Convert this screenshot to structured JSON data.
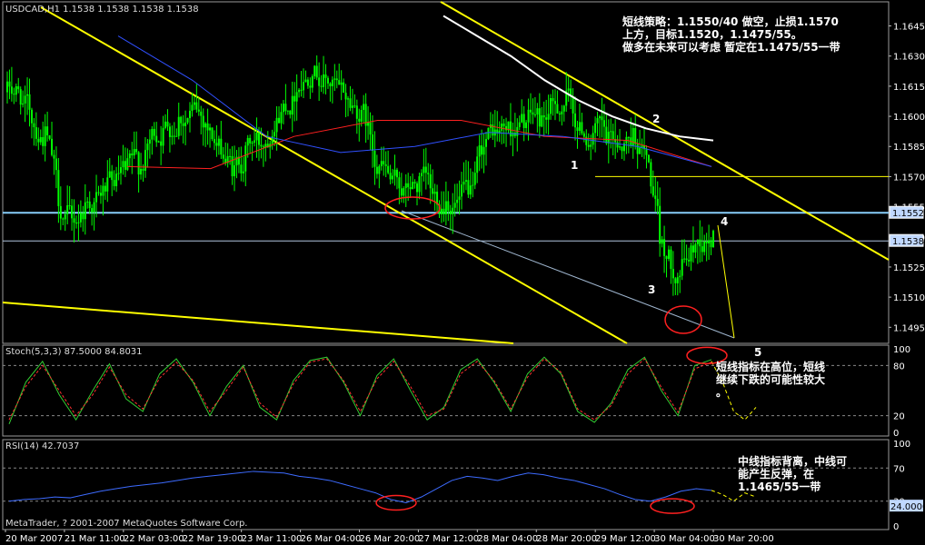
{
  "chart_data": {
    "type": "candlestick",
    "symbol_header": "USDCAD,H1  1.1538 1.1538 1.1538 1.1538",
    "price_axis": {
      "ylim": [
        1.1487,
        1.1657
      ],
      "ticks": [
        "1.1645",
        "1.1630",
        "1.1615",
        "1.1600",
        "1.1585",
        "1.1570",
        "1.1555",
        "1.1540",
        "1.1525",
        "1.1510",
        "1.1495"
      ],
      "tick_values": [
        1.1645,
        1.163,
        1.1615,
        1.16,
        1.1585,
        1.157,
        1.1555,
        1.154,
        1.1525,
        1.151,
        1.1495
      ],
      "current_price_tag": "1.1538",
      "current_price": 1.1538,
      "level_tag": "1.1552",
      "level_price": 1.1552,
      "resistance_level": 1.157
    },
    "x_axis": {
      "labels": [
        "20 Mar 2007",
        "21 Mar 11:00",
        "22 Mar 03:00",
        "22 Mar 19:00",
        "23 Mar 11:00",
        "26 Mar 04:00",
        "26 Mar 20:00",
        "27 Mar 12:00",
        "28 Mar 04:00",
        "28 Mar 20:00",
        "29 Mar 12:00",
        "30 Mar 04:00",
        "30 Mar 20:00"
      ]
    },
    "series": [
      {
        "name": "candles",
        "ohlc_values": [
          1.1612,
          1.16,
          1.159,
          1.156,
          1.1548,
          1.1555,
          1.156,
          1.1566,
          1.1572,
          1.1577,
          1.159,
          1.1595,
          1.1598,
          1.1602,
          1.1597,
          1.1583,
          1.1575,
          1.158,
          1.1588,
          1.1596,
          1.1608,
          1.1618,
          1.1625,
          1.1618,
          1.1612,
          1.1605,
          1.16,
          1.1575,
          1.1565,
          1.1562,
          1.1565,
          1.156,
          1.1558,
          1.1557,
          1.156,
          1.1588,
          1.1592,
          1.1593,
          1.1597,
          1.16,
          1.1605,
          1.1608,
          1.1592,
          1.159,
          1.1588,
          1.1587,
          1.159,
          1.158,
          1.154,
          1.1525,
          1.153,
          1.154,
          1.1538
        ]
      },
      {
        "name": "ma_white",
        "values": [
          1.165,
          1.164,
          1.163,
          1.1618,
          1.1608,
          1.16,
          1.1594,
          1.159,
          1.1588
        ]
      },
      {
        "name": "ma_red",
        "values": [
          1.1575,
          1.1574,
          1.159,
          1.1598,
          1.1598,
          1.159,
          1.1588,
          1.1575
        ]
      },
      {
        "name": "ma_blue",
        "values": [
          1.164,
          1.1618,
          1.159,
          1.1582,
          1.1585,
          1.1592,
          1.159,
          1.1585,
          1.1575
        ]
      }
    ],
    "lower_panels": [
      {
        "header": "Stoch(5,3,3) 87.5000 84.8031",
        "ylim": [
          0,
          100
        ],
        "ticks": [
          "100",
          "80",
          "20",
          "0"
        ],
        "tick_values": [
          100,
          80,
          20,
          0
        ],
        "main": [
          10,
          60,
          85,
          45,
          15,
          50,
          82,
          40,
          25,
          70,
          88,
          60,
          20,
          55,
          80,
          30,
          15,
          62,
          86,
          90,
          60,
          20,
          68,
          88,
          50,
          15,
          30,
          75,
          88,
          60,
          25,
          70,
          90,
          70,
          25,
          12,
          35,
          75,
          90,
          50,
          20,
          80,
          87
        ],
        "signal": [
          15,
          55,
          80,
          50,
          20,
          45,
          78,
          45,
          28,
          65,
          84,
          62,
          25,
          50,
          78,
          35,
          18,
          58,
          84,
          88,
          62,
          25,
          64,
          85,
          55,
          20,
          28,
          70,
          85,
          62,
          28,
          66,
          88,
          72,
          28,
          15,
          32,
          70,
          88,
          54,
          24,
          76,
          84
        ],
        "projection": [
          85,
          60,
          25,
          15,
          30
        ]
      },
      {
        "header": "RSI(14) 42.7037",
        "ylim": [
          0,
          100
        ],
        "ticks": [
          "100",
          "70",
          "30",
          "0"
        ],
        "tick_values": [
          100,
          70,
          30,
          0
        ],
        "level_tag": "24.0000",
        "level_value": 24,
        "values": [
          30,
          32,
          33,
          35,
          34,
          38,
          42,
          45,
          48,
          50,
          52,
          55,
          58,
          60,
          62,
          64,
          66,
          65,
          64,
          60,
          58,
          55,
          50,
          45,
          40,
          32,
          28,
          35,
          45,
          55,
          60,
          58,
          55,
          60,
          64,
          62,
          58,
          55,
          50,
          45,
          38,
          32,
          30,
          35,
          42,
          45,
          43
        ],
        "projection": [
          43,
          38,
          30,
          40,
          35
        ]
      }
    ],
    "wave_labels": [
      "1",
      "2",
      "3",
      "4",
      "5"
    ],
    "copyright": "MetaTrader, ? 2001-2007 MetaQuotes Software Corp."
  },
  "annotations": {
    "strategy": "短线策略：1.1550/40 做空，止损1.1570\n上方，目标1.1520，1.1475/55。\n做多在未来可以考虑 暂定在1.1475/55一带",
    "stoch_note": "短线指标在高位，短线\n继续下跌的可能性较大\n。",
    "rsi_note": "中线指标背离，中线可\n能产生反弹，在\n1.1465/55一带"
  },
  "colors": {
    "background": "#000000",
    "candle": "#00ff00",
    "stoch_main": "#32cd32",
    "stoch_signal": "#ff3030",
    "rsi": "#3d6bff",
    "trendline": "#ffff00",
    "level_line": "#87cefa",
    "ma_white": "#ffffff",
    "ma_red": "#ff2020",
    "ma_blue": "#3050ff",
    "ma_violet": "#d070ff",
    "ma_green": "#50c050",
    "circle": "#ff2020",
    "price_tag": "#c0d8ff",
    "text": "#ffffff",
    "grid": "#808080"
  }
}
